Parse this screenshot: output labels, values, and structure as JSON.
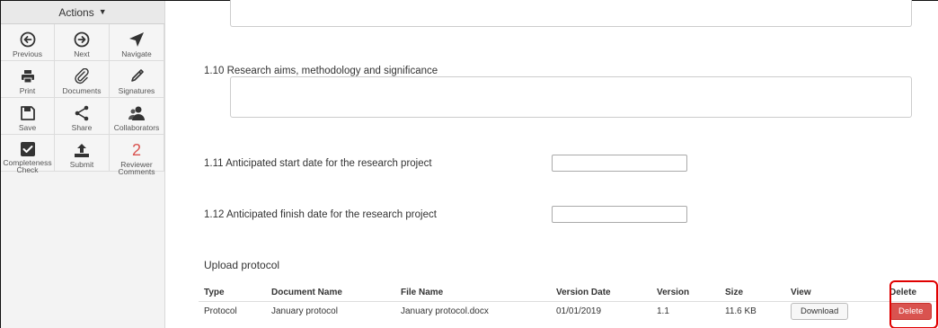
{
  "sidebar": {
    "actions_label": "Actions",
    "tiles": [
      {
        "name": "previous",
        "label": "Previous",
        "icon": "arrow-left-circle-icon"
      },
      {
        "name": "next",
        "label": "Next",
        "icon": "arrow-right-circle-icon"
      },
      {
        "name": "navigate",
        "label": "Navigate",
        "icon": "navigate-arrow-icon"
      },
      {
        "name": "print",
        "label": "Print",
        "icon": "printer-icon"
      },
      {
        "name": "documents",
        "label": "Documents",
        "icon": "paperclip-icon"
      },
      {
        "name": "signatures",
        "label": "Signatures",
        "icon": "pen-icon"
      },
      {
        "name": "save",
        "label": "Save",
        "icon": "floppy-icon"
      },
      {
        "name": "share",
        "label": "Share",
        "icon": "share-icon"
      },
      {
        "name": "collaborators",
        "label": "Collaborators",
        "icon": "users-icon"
      },
      {
        "name": "completeness-check",
        "label": "Completeness Check",
        "icon": "checkbox-icon"
      },
      {
        "name": "submit",
        "label": "Submit",
        "icon": "upload-icon"
      },
      {
        "name": "reviewer-comments",
        "label": "Reviewer Comments",
        "count": "2"
      }
    ]
  },
  "form": {
    "q110_label": "1.10  Research aims, methodology and significance",
    "q111_label": "1.11  Anticipated start date for the research project",
    "q112_label": "1.12  Anticipated finish date for the research project",
    "upload_title": "Upload protocol"
  },
  "protocol_table": {
    "headers": [
      "Type",
      "Document Name",
      "File Name",
      "Version Date",
      "Version",
      "Size",
      "View",
      "Delete"
    ],
    "rows": [
      {
        "type": "Protocol",
        "document_name": "January protocol",
        "file_name": "January protocol.docx",
        "version_date": "01/01/2019",
        "version": "1.1",
        "size": "11.6 KB",
        "view_label": "Download",
        "delete_label": "Delete"
      }
    ]
  },
  "colors": {
    "accent_red": "#d9534f",
    "highlight_red": "#e00000"
  }
}
